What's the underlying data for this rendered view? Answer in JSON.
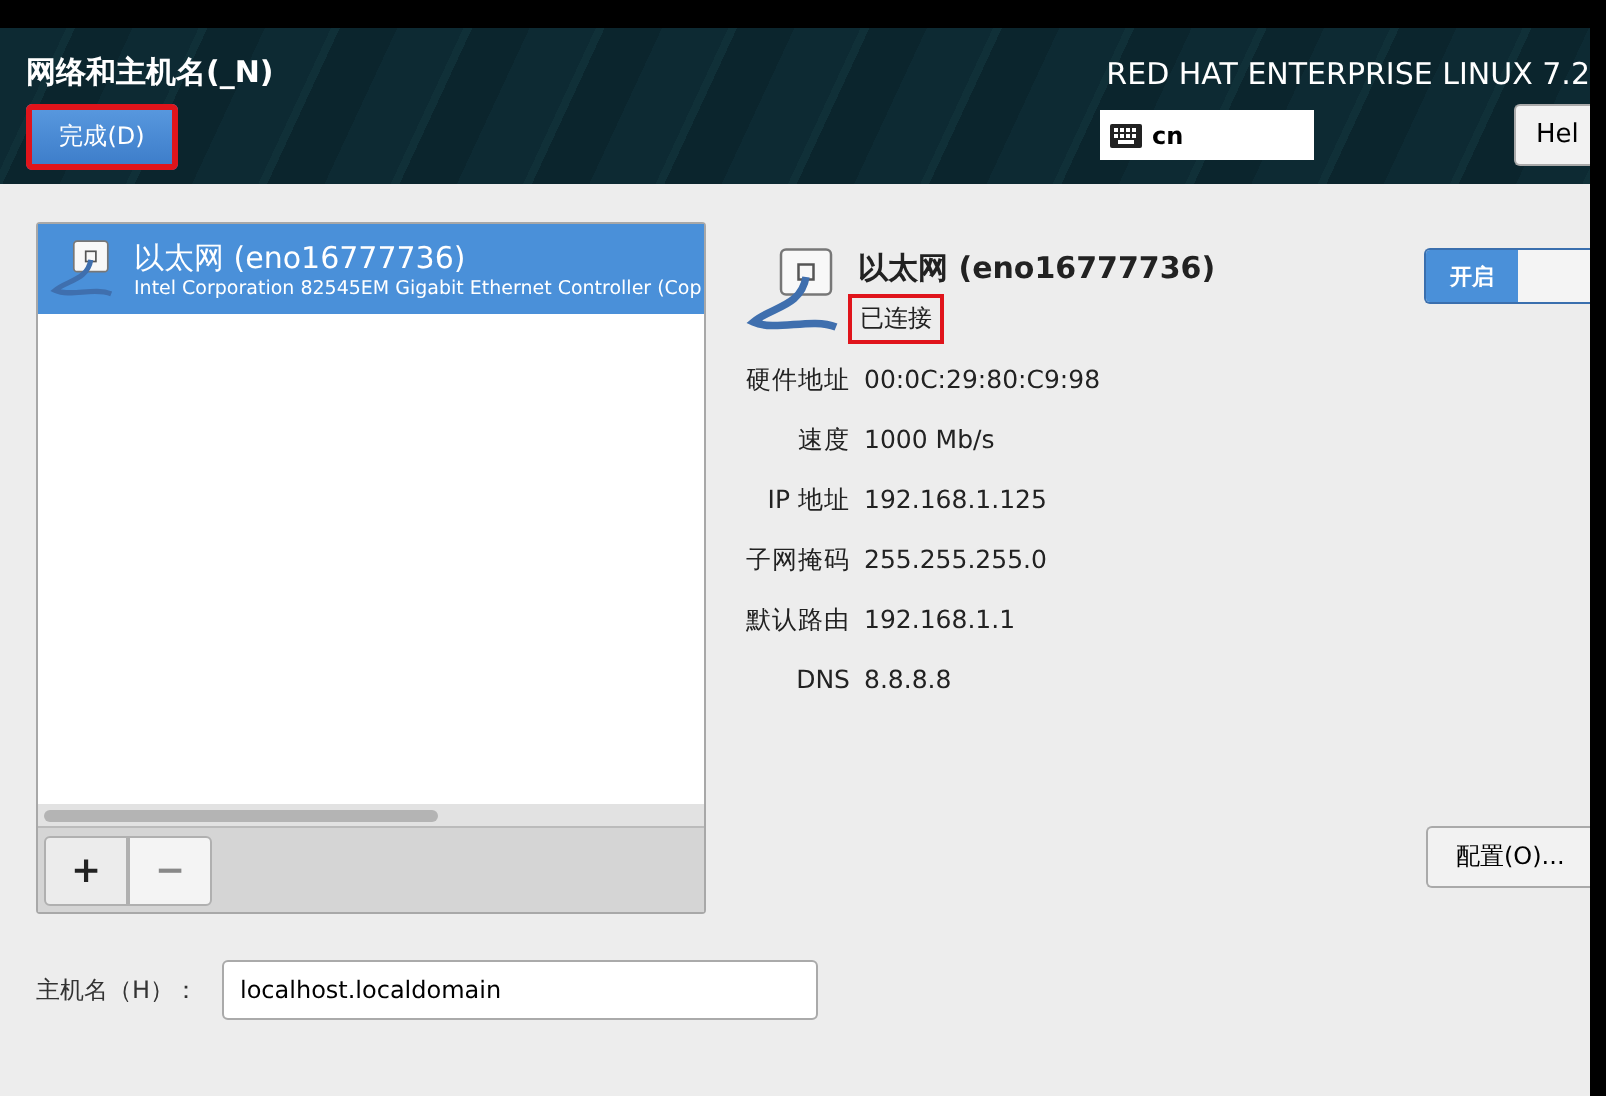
{
  "header": {
    "title": "网络和主机名(_N)",
    "done_button": {
      "label": "完成(D)",
      "highlighted": true
    },
    "product": "RED HAT ENTERPRISE LINUX 7.2",
    "keyboard": {
      "value": "cn"
    },
    "help_button": "Hel"
  },
  "devices": [
    {
      "name": "以太网 (eno16777736)",
      "description": "Intel Corporation 82545EM Gigabit Ethernet Controller (Cop",
      "selected": true
    }
  ],
  "list_buttons": [
    "+",
    "−"
  ],
  "detail": {
    "name": "以太网 (eno16777736)",
    "status": {
      "text": "已连接",
      "highlighted": true
    },
    "properties": [
      {
        "label": "硬件地址",
        "value": "00:0C:29:80:C9:98"
      },
      {
        "label": "速度",
        "value": "1000 Mb/s"
      },
      {
        "label": "IP 地址",
        "value": "192.168.1.125"
      },
      {
        "label": "子网掩码",
        "value": "255.255.255.0"
      },
      {
        "label": "默认路由",
        "value": "192.168.1.1"
      },
      {
        "label": "DNS",
        "value": "8.8.8.8"
      }
    ],
    "switch": {
      "label": "开启",
      "on": true
    },
    "configure_button": "配置(O)..."
  },
  "hostname": {
    "label": "主机名（H）：",
    "value": "localhost.localdomain"
  }
}
